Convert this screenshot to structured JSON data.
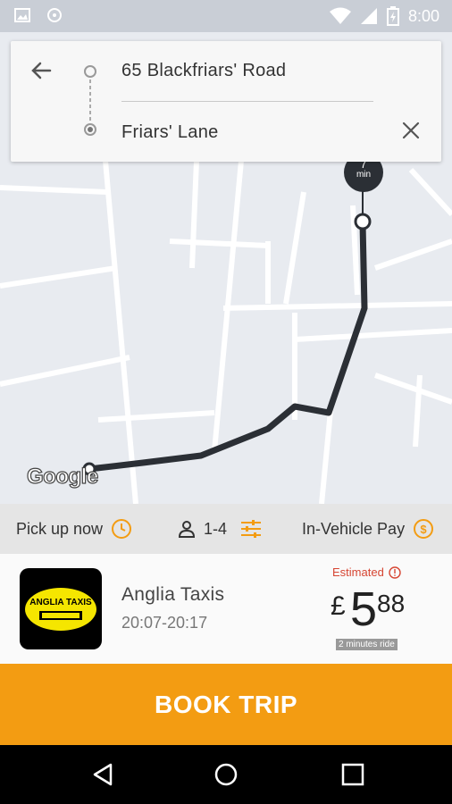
{
  "statusbar": {
    "time": "8:00"
  },
  "search": {
    "origin": "65 Blackfriars' Road",
    "destination": "Friars' Lane"
  },
  "map": {
    "eta_value": "7",
    "eta_unit": "min",
    "attribution": "Google"
  },
  "options": {
    "pickup_label": "Pick up now",
    "passengers_label": "1-4",
    "payment_label": "In-Vehicle Pay"
  },
  "provider": {
    "logo_text": "ANGLIA TAXIS",
    "name": "Anglia Taxis",
    "time_window": "20:07-20:17",
    "estimated_label": "Estimated",
    "currency": "£",
    "price_major": "5",
    "price_minor": "88",
    "ride_duration": "2 minutes ride"
  },
  "actions": {
    "book_label": "BOOK TRIP"
  },
  "colors": {
    "accent": "#f39c12",
    "estimated": "#d64532",
    "route": "#2b2f35"
  }
}
